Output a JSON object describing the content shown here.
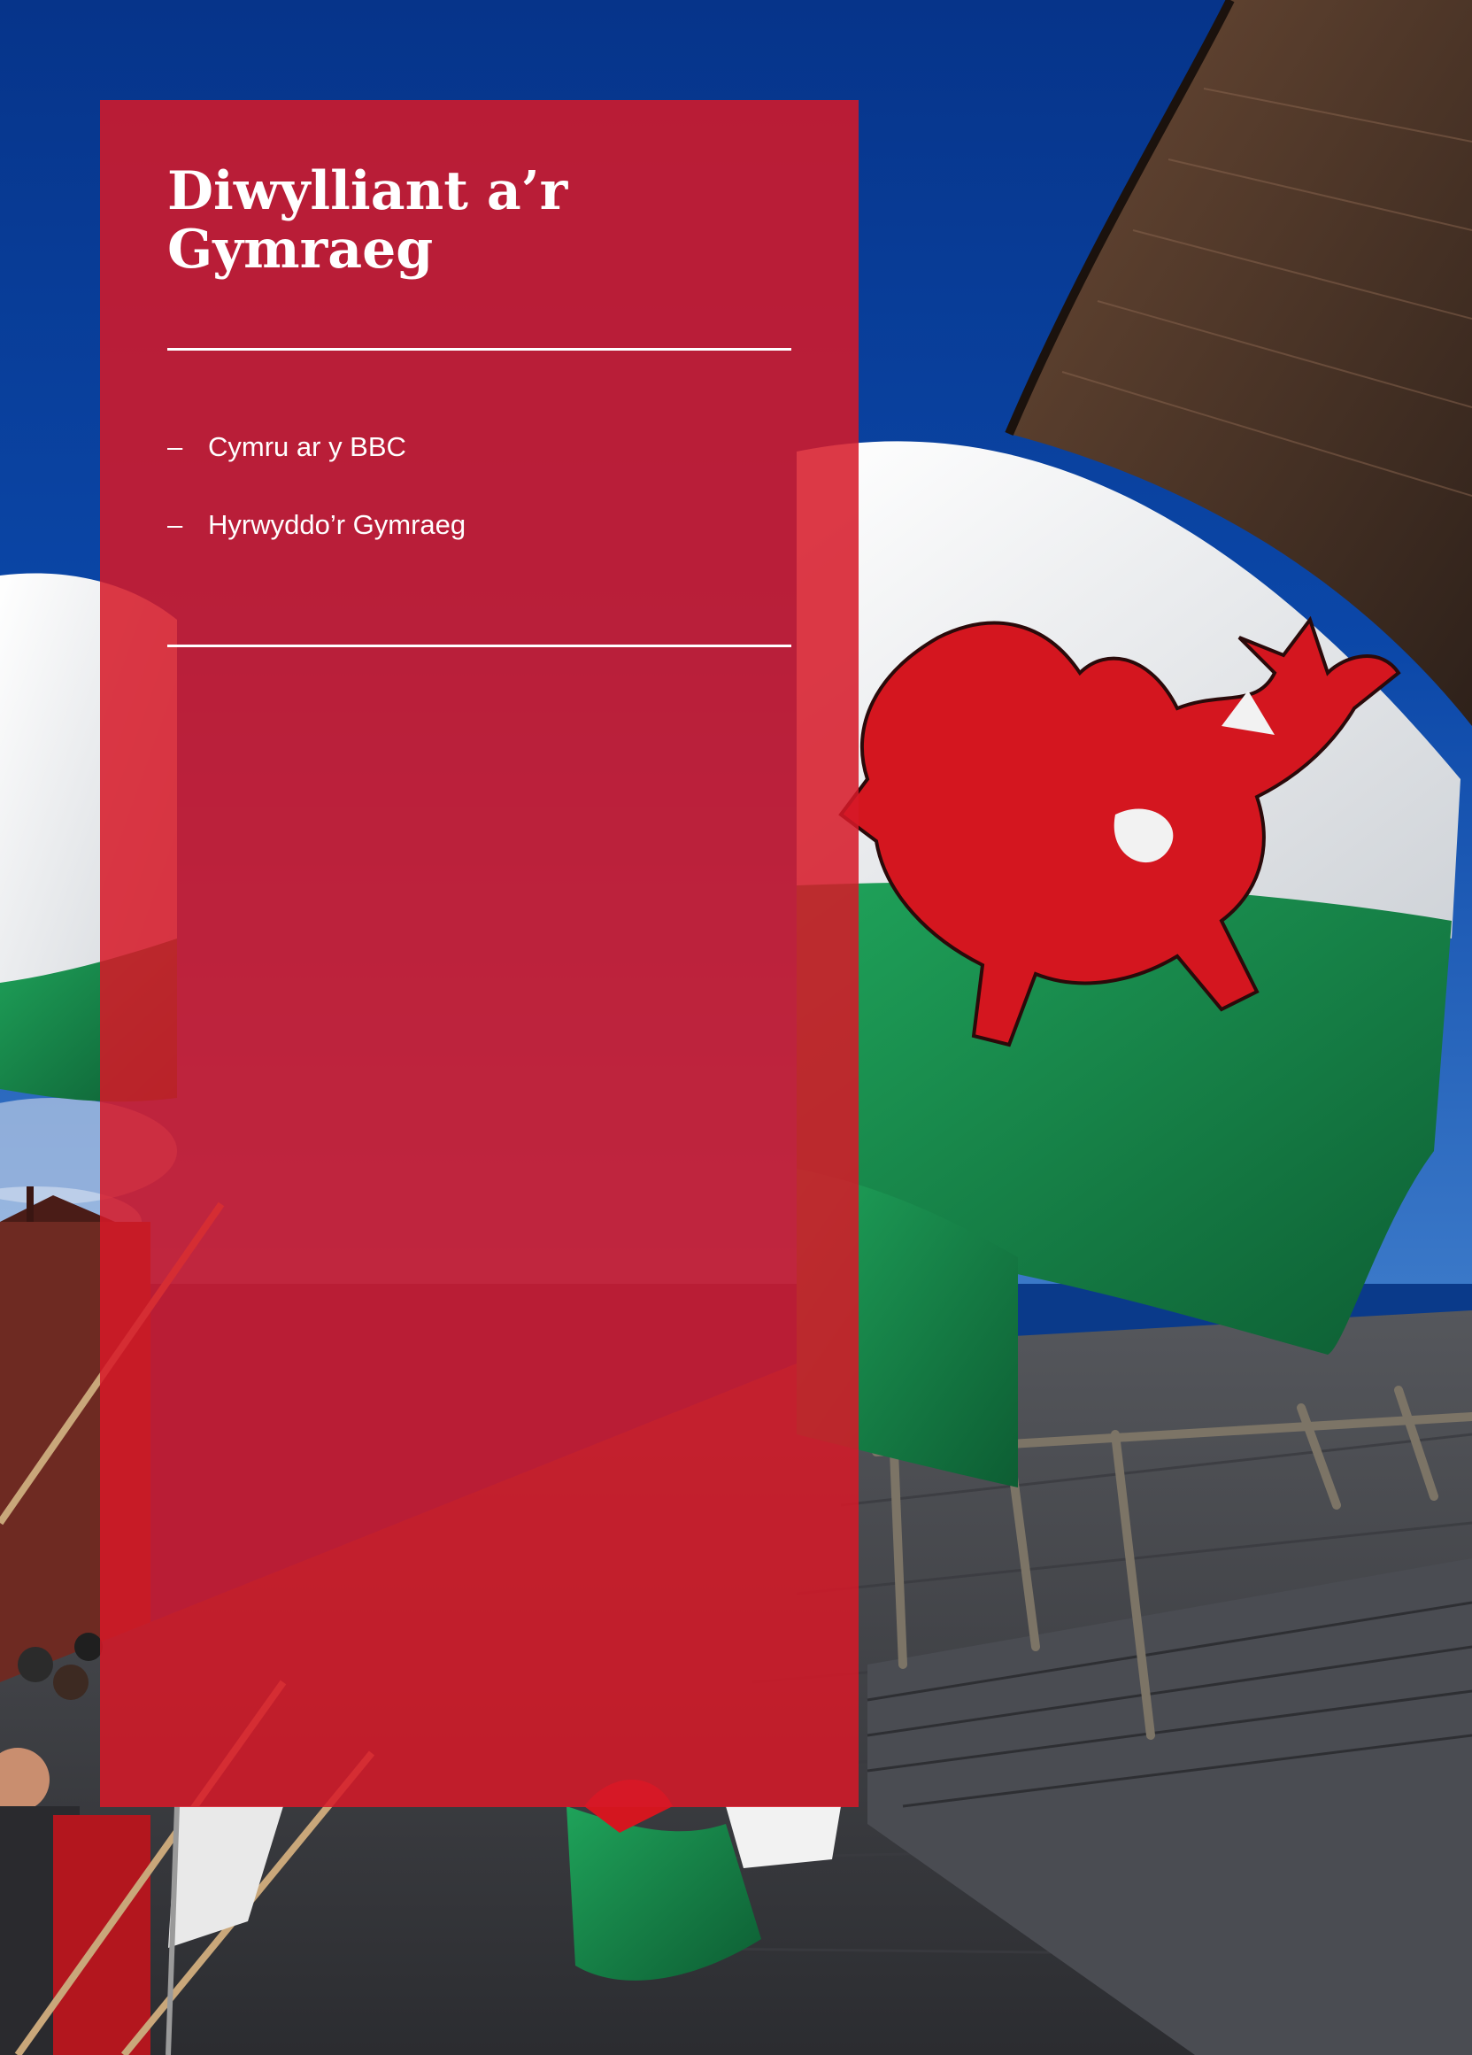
{
  "title": "Diwylliant a’r Gymraeg",
  "contents": {
    "dash": "–",
    "items": [
      {
        "label": "Cymru ar y BBC"
      },
      {
        "label": "Hyrwyddo’r Gymraeg"
      }
    ]
  },
  "background_image": {
    "subject": "Welsh flags waving outside the Senedd building",
    "icon": "welsh-dragon-flag"
  },
  "colors": {
    "panel": "#d61828",
    "sky": "#0a3a8a",
    "flag_green": "#1b8c4e",
    "flag_white": "#f2f2f2",
    "dragon_red": "#d4161f"
  }
}
